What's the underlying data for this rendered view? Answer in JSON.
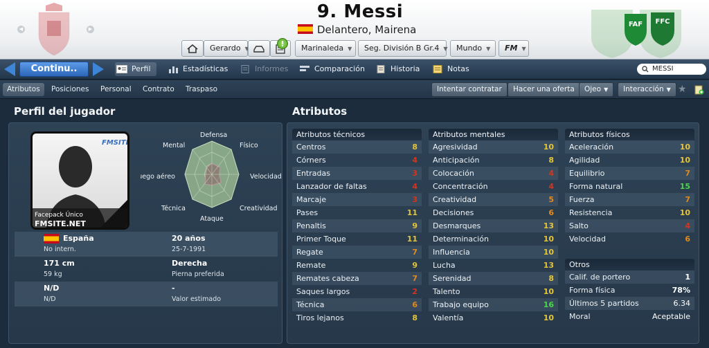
{
  "header": {
    "title": "9. Messi",
    "subtitle": "Delantero, Mairena",
    "manager": "Gerardo",
    "location": "Marinaleda",
    "competition": "Seg. División B Gr.4",
    "world": "Mundo",
    "fm": "FM",
    "alert": "!"
  },
  "nav": {
    "continue": "Continu..",
    "tabs": [
      "Perfil",
      "Estadísticas",
      "Informes",
      "Comparación",
      "Historia",
      "Notas"
    ],
    "search": "MESSI"
  },
  "subnav": {
    "tabs": [
      "Atributos",
      "Posiciones",
      "Personal",
      "Contrato",
      "Traspaso"
    ],
    "actions": [
      "Intentar contratar",
      "Hacer una oferta",
      "Ojeo",
      "Interacción"
    ]
  },
  "profile": {
    "title": "Perfil del jugador",
    "photo_caption1": "Facepack  Único",
    "photo_caption2": "FMSITE.NET",
    "radar_labels": [
      "Defensa",
      "Físico",
      "Velocidad",
      "Creatividad",
      "Ataque",
      "Técnica",
      "Juego aéreo",
      "Mental"
    ],
    "info": [
      {
        "left": "España",
        "left_sub": "No intern.",
        "right": "20 años",
        "right_sub": "25-7-1991"
      },
      {
        "left": "171 cm",
        "left_sub": "59 kg",
        "right": "Derecha",
        "right_sub": "Pierna preferida"
      },
      {
        "left": "N/D",
        "left_sub": "N/D",
        "right": "-",
        "right_sub": "Valor estimado"
      }
    ]
  },
  "attributes": {
    "title": "Atributos",
    "technical": {
      "title": "Atributos técnicos",
      "items": [
        {
          "name": "Centros",
          "value": "8"
        },
        {
          "name": "Córners",
          "value": "4"
        },
        {
          "name": "Entradas",
          "value": "3"
        },
        {
          "name": "Lanzador de faltas",
          "value": "4"
        },
        {
          "name": "Marcaje",
          "value": "3"
        },
        {
          "name": "Pases",
          "value": "11"
        },
        {
          "name": "Penaltis",
          "value": "9"
        },
        {
          "name": "Primer Toque",
          "value": "11"
        },
        {
          "name": "Regate",
          "value": "7"
        },
        {
          "name": "Remate",
          "value": "9"
        },
        {
          "name": "Remates cabeza",
          "value": "7"
        },
        {
          "name": "Saques largos",
          "value": "2"
        },
        {
          "name": "Técnica",
          "value": "6"
        },
        {
          "name": "Tiros lejanos",
          "value": "8"
        }
      ]
    },
    "mental": {
      "title": "Atributos mentales",
      "items": [
        {
          "name": "Agresividad",
          "value": "10"
        },
        {
          "name": "Anticipación",
          "value": "8"
        },
        {
          "name": "Colocación",
          "value": "4"
        },
        {
          "name": "Concentración",
          "value": "4"
        },
        {
          "name": "Creatividad",
          "value": "5"
        },
        {
          "name": "Decisiones",
          "value": "6"
        },
        {
          "name": "Desmarques",
          "value": "13"
        },
        {
          "name": "Determinación",
          "value": "10"
        },
        {
          "name": "Influencia",
          "value": "10"
        },
        {
          "name": "Lucha",
          "value": "13"
        },
        {
          "name": "Serenidad",
          "value": "8"
        },
        {
          "name": "Talento",
          "value": "10"
        },
        {
          "name": "Trabajo equipo",
          "value": "16"
        },
        {
          "name": "Valentía",
          "value": "10"
        }
      ]
    },
    "physical": {
      "title": "Atributos físicos",
      "items": [
        {
          "name": "Aceleración",
          "value": "10"
        },
        {
          "name": "Agilidad",
          "value": "10"
        },
        {
          "name": "Equilibrio",
          "value": "7"
        },
        {
          "name": "Forma natural",
          "value": "15"
        },
        {
          "name": "Fuerza",
          "value": "7"
        },
        {
          "name": "Resistencia",
          "value": "10"
        },
        {
          "name": "Salto",
          "value": "4"
        },
        {
          "name": "Velocidad",
          "value": "6"
        }
      ]
    },
    "others": {
      "title": "Otros",
      "items": [
        {
          "name": "Calif. de portero",
          "value": "1"
        },
        {
          "name": "Forma física",
          "value": "78%"
        },
        {
          "name": "Últimos 5 partidos",
          "value": "6.34"
        },
        {
          "name": "Moral",
          "value": "Aceptable"
        }
      ]
    }
  },
  "colors": {
    "accent": "#2b66b8",
    "value_low": "#d3351f",
    "value_mid": "#e38a1f",
    "value_good": "#e4c53a",
    "value_high": "#4cd64a"
  }
}
